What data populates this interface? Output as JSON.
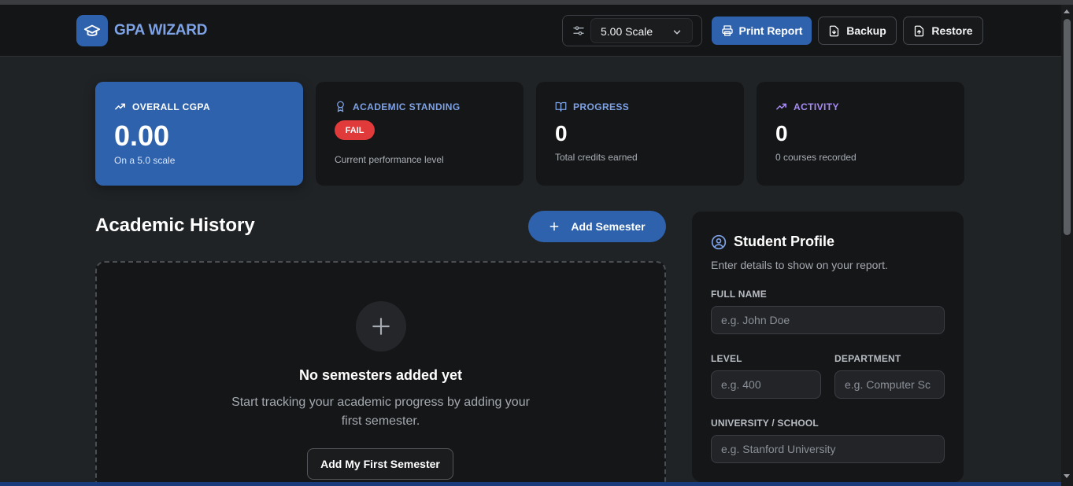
{
  "brand": {
    "name": "GPA WIZARD",
    "icon": "graduation-cap-icon"
  },
  "toolbar": {
    "scale_value": "5.00 Scale",
    "print_label": "Print Report",
    "backup_label": "Backup",
    "restore_label": "Restore"
  },
  "stats": {
    "cgpa": {
      "title": "OVERALL CGPA",
      "value": "0.00",
      "sub": "On a 5.0 scale"
    },
    "standing": {
      "title": "ACADEMIC STANDING",
      "badge": "FAIL",
      "sub": "Current performance level"
    },
    "progress": {
      "title": "PROGRESS",
      "value": "0",
      "sub": "Total credits earned"
    },
    "activity": {
      "title": "ACTIVITY",
      "value": "0",
      "sub": "0 courses recorded"
    }
  },
  "history": {
    "title": "Academic History",
    "add_label": "Add Semester",
    "empty_title": "No semesters added yet",
    "empty_desc": "Start tracking your academic progress by adding your first semester.",
    "first_label": "Add My First Semester"
  },
  "profile": {
    "title": "Student Profile",
    "desc": "Enter details to show on your report.",
    "full_name_label": "FULL NAME",
    "full_name_placeholder": "e.g. John Doe",
    "level_label": "LEVEL",
    "level_placeholder": "e.g. 400",
    "department_label": "DEPARTMENT",
    "department_placeholder": "e.g. Computer Sc",
    "school_label": "UNIVERSITY / SCHOOL",
    "school_placeholder": "e.g. Stanford University"
  },
  "colors": {
    "accent": "#2f62ad",
    "brand_text": "#7ea2e6",
    "fail": "#e03a3a",
    "activity": "#a88cf5",
    "label_blue": "#7ea2e6"
  }
}
